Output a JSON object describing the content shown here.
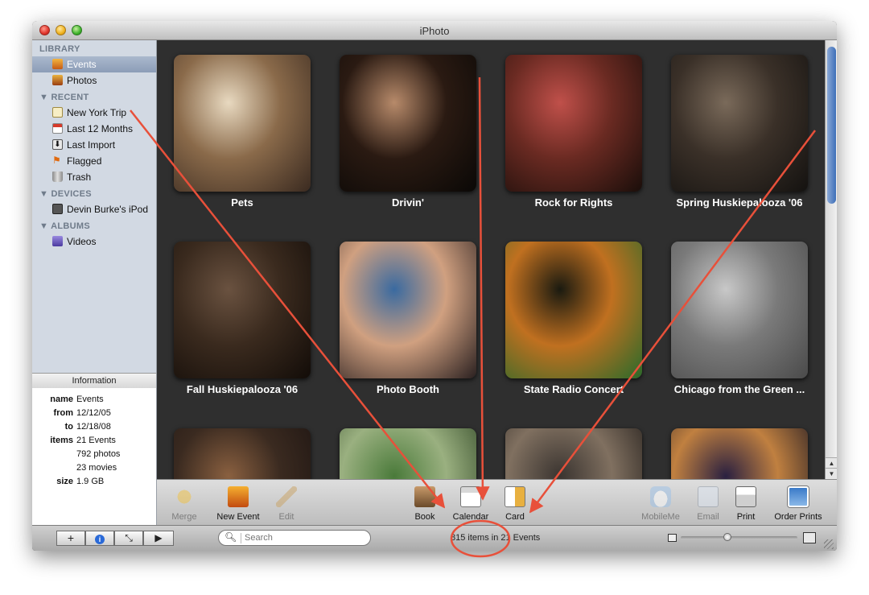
{
  "window": {
    "title": "iPhoto"
  },
  "sidebar": {
    "library_header": "LIBRARY",
    "recent_header": "RECENT",
    "devices_header": "DEVICES",
    "albums_header": "ALBUMS",
    "library": [
      {
        "label": "Events",
        "icon": "events-icon",
        "selected": true
      },
      {
        "label": "Photos",
        "icon": "photos-icon",
        "selected": false
      }
    ],
    "recent": [
      {
        "label": "New York Trip",
        "icon": "event-icon"
      },
      {
        "label": "Last 12 Months",
        "icon": "calendar-icon"
      },
      {
        "label": "Last Import",
        "icon": "import-icon"
      },
      {
        "label": "Flagged",
        "icon": "flag-icon"
      },
      {
        "label": "Trash",
        "icon": "trash-icon"
      }
    ],
    "devices": [
      {
        "label": "Devin Burke's iPod",
        "icon": "ipod-icon"
      }
    ],
    "albums": [
      {
        "label": "Videos",
        "icon": "videos-album-icon"
      }
    ]
  },
  "information": {
    "header": "Information",
    "rows": [
      {
        "key": "name",
        "value": "Events"
      },
      {
        "key": "from",
        "value": "12/12/05"
      },
      {
        "key": "to",
        "value": "12/18/08"
      },
      {
        "key": "items",
        "value": "21 Events"
      },
      {
        "key": "",
        "value": "792 photos"
      },
      {
        "key": "",
        "value": "23 movies"
      },
      {
        "key": "size",
        "value": "1.9 GB"
      }
    ]
  },
  "events": [
    {
      "title": "Pets",
      "colors": [
        "#e8d9c0",
        "#8a6a4a",
        "#3a2a20"
      ]
    },
    {
      "title": "Drivin'",
      "colors": [
        "#b78a6a",
        "#2a1a12",
        "#0a0806"
      ]
    },
    {
      "title": "Rock for Rights",
      "colors": [
        "#c0504a",
        "#6a2a22",
        "#1a0e0a"
      ]
    },
    {
      "title": "Spring Huskiepalooza '06",
      "colors": [
        "#7a6a5a",
        "#3a3028",
        "#141210"
      ]
    },
    {
      "title": "Fall Huskiepalooza '06",
      "colors": [
        "#6a5240",
        "#3a2a1e",
        "#120c08"
      ]
    },
    {
      "title": "Photo Booth",
      "colors": [
        "#3a6aa0",
        "#d0a080",
        "#2a2020"
      ]
    },
    {
      "title": "State Radio Concert",
      "colors": [
        "#1a1a10",
        "#c07020",
        "#2a6a2a"
      ]
    },
    {
      "title": "Chicago from the Green ...",
      "colors": [
        "#c8c8c8",
        "#7a7a7a",
        "#4a4a4a"
      ]
    },
    {
      "title": "",
      "colors": [
        "#8a6040",
        "#3a2a20",
        "#1a1210"
      ]
    },
    {
      "title": "",
      "colors": [
        "#4a7a3a",
        "#9ab080",
        "#2a4020"
      ]
    },
    {
      "title": "",
      "colors": [
        "#3a3430",
        "#807060",
        "#1a1614"
      ]
    },
    {
      "title": "",
      "colors": [
        "#2a2040",
        "#c08040",
        "#101020"
      ]
    }
  ],
  "toolbar": {
    "merge": "Merge",
    "new_event": "New Event",
    "edit": "Edit",
    "book": "Book",
    "calendar": "Calendar",
    "card": "Card",
    "mobileme": "MobileMe",
    "email": "Email",
    "print": "Print",
    "order_prints": "Order Prints"
  },
  "bottombar": {
    "add": "+",
    "info": "i",
    "fullscreen": "⤡",
    "play": "▶",
    "search_placeholder": "Search",
    "status": "815 items in 21 Events",
    "zoom_level": 0.4
  },
  "annotation": {
    "arrow_color": "#e8503a"
  }
}
